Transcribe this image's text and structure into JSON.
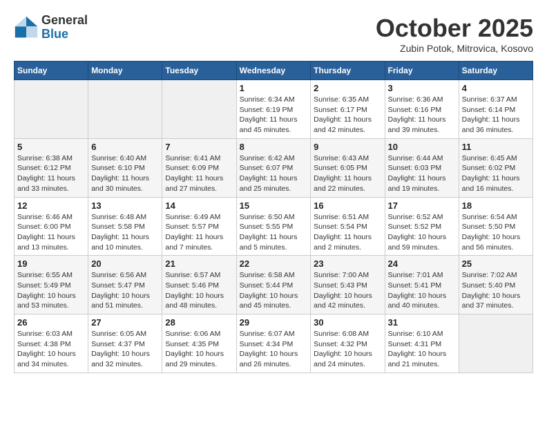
{
  "header": {
    "logo_general": "General",
    "logo_blue": "Blue",
    "month_title": "October 2025",
    "subtitle": "Zubin Potok, Mitrovica, Kosovo"
  },
  "days_of_week": [
    "Sunday",
    "Monday",
    "Tuesday",
    "Wednesday",
    "Thursday",
    "Friday",
    "Saturday"
  ],
  "weeks": [
    [
      {
        "day": "",
        "info": ""
      },
      {
        "day": "",
        "info": ""
      },
      {
        "day": "",
        "info": ""
      },
      {
        "day": "1",
        "info": "Sunrise: 6:34 AM\nSunset: 6:19 PM\nDaylight: 11 hours\nand 45 minutes."
      },
      {
        "day": "2",
        "info": "Sunrise: 6:35 AM\nSunset: 6:17 PM\nDaylight: 11 hours\nand 42 minutes."
      },
      {
        "day": "3",
        "info": "Sunrise: 6:36 AM\nSunset: 6:16 PM\nDaylight: 11 hours\nand 39 minutes."
      },
      {
        "day": "4",
        "info": "Sunrise: 6:37 AM\nSunset: 6:14 PM\nDaylight: 11 hours\nand 36 minutes."
      }
    ],
    [
      {
        "day": "5",
        "info": "Sunrise: 6:38 AM\nSunset: 6:12 PM\nDaylight: 11 hours\nand 33 minutes."
      },
      {
        "day": "6",
        "info": "Sunrise: 6:40 AM\nSunset: 6:10 PM\nDaylight: 11 hours\nand 30 minutes."
      },
      {
        "day": "7",
        "info": "Sunrise: 6:41 AM\nSunset: 6:09 PM\nDaylight: 11 hours\nand 27 minutes."
      },
      {
        "day": "8",
        "info": "Sunrise: 6:42 AM\nSunset: 6:07 PM\nDaylight: 11 hours\nand 25 minutes."
      },
      {
        "day": "9",
        "info": "Sunrise: 6:43 AM\nSunset: 6:05 PM\nDaylight: 11 hours\nand 22 minutes."
      },
      {
        "day": "10",
        "info": "Sunrise: 6:44 AM\nSunset: 6:03 PM\nDaylight: 11 hours\nand 19 minutes."
      },
      {
        "day": "11",
        "info": "Sunrise: 6:45 AM\nSunset: 6:02 PM\nDaylight: 11 hours\nand 16 minutes."
      }
    ],
    [
      {
        "day": "12",
        "info": "Sunrise: 6:46 AM\nSunset: 6:00 PM\nDaylight: 11 hours\nand 13 minutes."
      },
      {
        "day": "13",
        "info": "Sunrise: 6:48 AM\nSunset: 5:58 PM\nDaylight: 11 hours\nand 10 minutes."
      },
      {
        "day": "14",
        "info": "Sunrise: 6:49 AM\nSunset: 5:57 PM\nDaylight: 11 hours\nand 7 minutes."
      },
      {
        "day": "15",
        "info": "Sunrise: 6:50 AM\nSunset: 5:55 PM\nDaylight: 11 hours\nand 5 minutes."
      },
      {
        "day": "16",
        "info": "Sunrise: 6:51 AM\nSunset: 5:54 PM\nDaylight: 11 hours\nand 2 minutes."
      },
      {
        "day": "17",
        "info": "Sunrise: 6:52 AM\nSunset: 5:52 PM\nDaylight: 10 hours\nand 59 minutes."
      },
      {
        "day": "18",
        "info": "Sunrise: 6:54 AM\nSunset: 5:50 PM\nDaylight: 10 hours\nand 56 minutes."
      }
    ],
    [
      {
        "day": "19",
        "info": "Sunrise: 6:55 AM\nSunset: 5:49 PM\nDaylight: 10 hours\nand 53 minutes."
      },
      {
        "day": "20",
        "info": "Sunrise: 6:56 AM\nSunset: 5:47 PM\nDaylight: 10 hours\nand 51 minutes."
      },
      {
        "day": "21",
        "info": "Sunrise: 6:57 AM\nSunset: 5:46 PM\nDaylight: 10 hours\nand 48 minutes."
      },
      {
        "day": "22",
        "info": "Sunrise: 6:58 AM\nSunset: 5:44 PM\nDaylight: 10 hours\nand 45 minutes."
      },
      {
        "day": "23",
        "info": "Sunrise: 7:00 AM\nSunset: 5:43 PM\nDaylight: 10 hours\nand 42 minutes."
      },
      {
        "day": "24",
        "info": "Sunrise: 7:01 AM\nSunset: 5:41 PM\nDaylight: 10 hours\nand 40 minutes."
      },
      {
        "day": "25",
        "info": "Sunrise: 7:02 AM\nSunset: 5:40 PM\nDaylight: 10 hours\nand 37 minutes."
      }
    ],
    [
      {
        "day": "26",
        "info": "Sunrise: 6:03 AM\nSunset: 4:38 PM\nDaylight: 10 hours\nand 34 minutes."
      },
      {
        "day": "27",
        "info": "Sunrise: 6:05 AM\nSunset: 4:37 PM\nDaylight: 10 hours\nand 32 minutes."
      },
      {
        "day": "28",
        "info": "Sunrise: 6:06 AM\nSunset: 4:35 PM\nDaylight: 10 hours\nand 29 minutes."
      },
      {
        "day": "29",
        "info": "Sunrise: 6:07 AM\nSunset: 4:34 PM\nDaylight: 10 hours\nand 26 minutes."
      },
      {
        "day": "30",
        "info": "Sunrise: 6:08 AM\nSunset: 4:32 PM\nDaylight: 10 hours\nand 24 minutes."
      },
      {
        "day": "31",
        "info": "Sunrise: 6:10 AM\nSunset: 4:31 PM\nDaylight: 10 hours\nand 21 minutes."
      },
      {
        "day": "",
        "info": ""
      }
    ]
  ]
}
